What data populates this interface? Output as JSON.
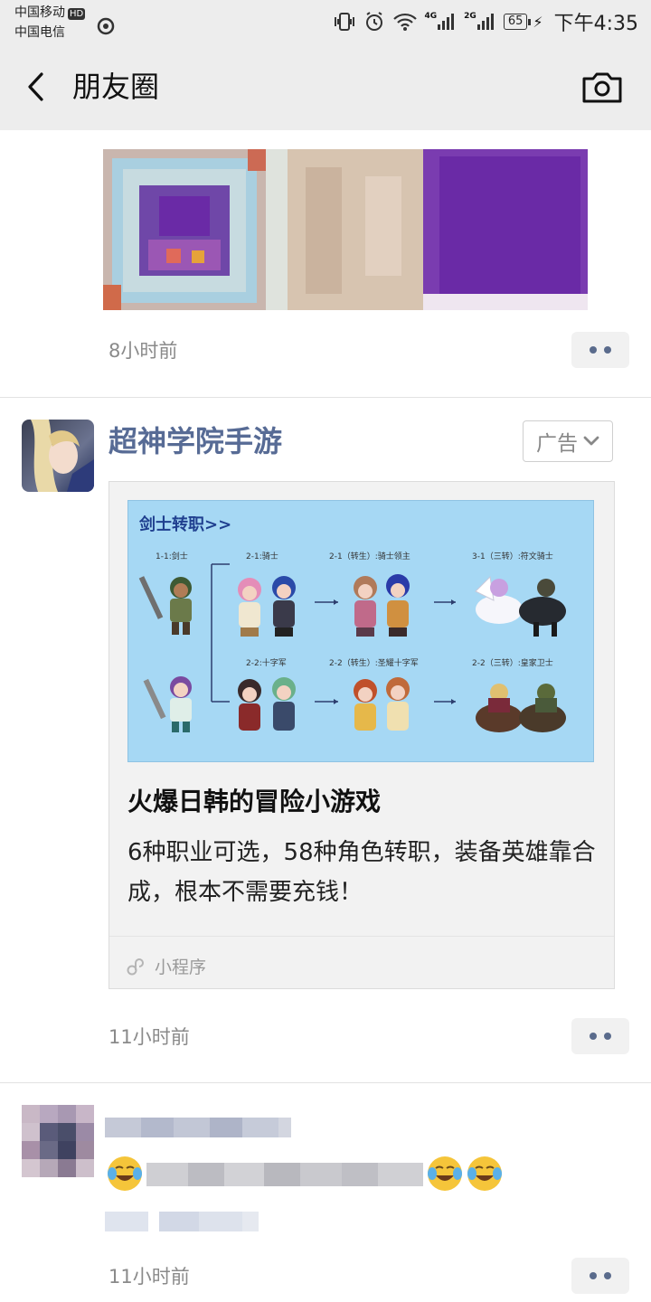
{
  "status_bar": {
    "carrier1": "中国移动",
    "hd": "HD",
    "carrier2": "中国电信",
    "net1": "4G",
    "net2": "2G",
    "battery": "65",
    "time": "下午4:35"
  },
  "nav": {
    "title": "朋友圈"
  },
  "posts": [
    {
      "time": "8小时前"
    },
    {
      "author": "超神学院手游",
      "ad_label": "广告",
      "card": {
        "image": {
          "heading": "剑士转职>>",
          "labels": [
            "1-1:剑士",
            "2-1:骑士",
            "2-1（转生）:骑士领主",
            "3-1（三转）:符文骑士",
            "2-2:十字军",
            "2-2（转生）:圣耀十字军",
            "2-2（三转）:皇家卫士"
          ]
        },
        "title": "火爆日韩的冒险小游戏",
        "desc": "6种职业可选，58种角色转职，装备英雄靠合成，根本不需要充钱！",
        "mini_program": "小程序"
      },
      "time": "11小时前"
    },
    {
      "time": "11小时前"
    }
  ],
  "colors": {
    "link": "#576b95",
    "bar_bg": "#ededed",
    "card_image_bg": "#a6d8f4",
    "mosaic_purple": "#6a2aa6"
  },
  "icons": [
    "back-chevron-icon",
    "camera-icon",
    "chevron-down-icon",
    "link-icon",
    "more-dots-icon",
    "laugh-cry-emoji-icon"
  ]
}
